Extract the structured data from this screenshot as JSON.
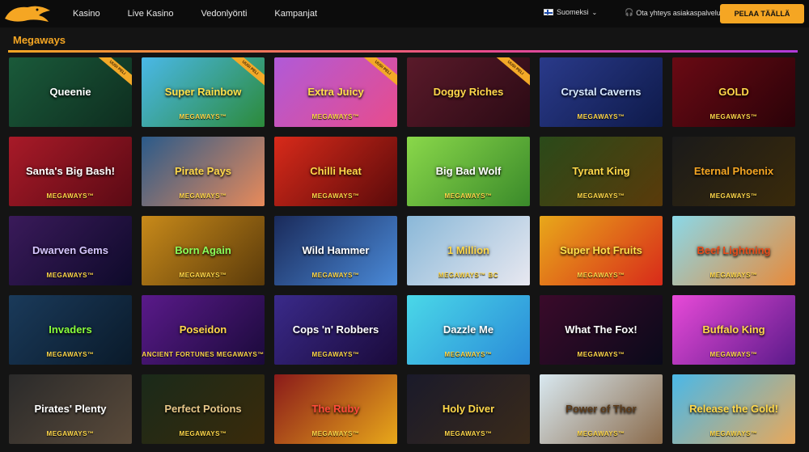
{
  "nav": {
    "items": [
      "Kasino",
      "Live Kasino",
      "Vedonlyönti",
      "Kampanjat"
    ],
    "language": "Suomeksi",
    "support": "Ota yhteys asiakaspalveluun",
    "cta": "PELAA TÄÄLLÄ"
  },
  "section": {
    "title": "Megaways"
  },
  "games": [
    {
      "title": "Queenie",
      "mega": "",
      "ribbon": "UUSI PELI",
      "bg": "linear-gradient(135deg,#1a5a3a,#0e2d1f)",
      "color": "#ffffff"
    },
    {
      "title": "Super Rainbow",
      "mega": "MEGAWAYS™",
      "ribbon": "UUSI PELI",
      "bg": "linear-gradient(135deg,#4ab8e8,#2c8a3a)",
      "color": "#ffe04a"
    },
    {
      "title": "Extra Juicy",
      "mega": "MEGAWAYS™",
      "ribbon": "UUSI PELI",
      "bg": "linear-gradient(135deg,#b05ad8,#e84c8c)",
      "color": "#ffe04a"
    },
    {
      "title": "Doggy Riches",
      "mega": "",
      "ribbon": "UUSI PELI",
      "bg": "linear-gradient(135deg,#5a1a2a,#2a0a14)",
      "color": "#ffd84a"
    },
    {
      "title": "Crystal Caverns",
      "mega": "MEGAWAYS™",
      "ribbon": "",
      "bg": "linear-gradient(135deg,#2a3a8a,#0e1a4a)",
      "color": "#d8eaff"
    },
    {
      "title": "GOLD",
      "mega": "MEGAWAYS™",
      "ribbon": "",
      "bg": "linear-gradient(135deg,#6a0a14,#2a0208)",
      "color": "#ffd84a"
    },
    {
      "title": "Santa's Big Bash!",
      "mega": "MEGAWAYS™",
      "ribbon": "",
      "bg": "linear-gradient(135deg,#a81a28,#5a0a14)",
      "color": "#ffffff"
    },
    {
      "title": "Pirate Pays",
      "mega": "MEGAWAYS™",
      "ribbon": "",
      "bg": "linear-gradient(135deg,#2a5a8a,#e88a5a)",
      "color": "#ffd84a"
    },
    {
      "title": "Chilli Heat",
      "mega": "MEGAWAYS™",
      "ribbon": "",
      "bg": "linear-gradient(135deg,#d82a1a,#5a0a0a)",
      "color": "#ffd84a"
    },
    {
      "title": "Big Bad Wolf",
      "mega": "MEGAWAYS™",
      "ribbon": "",
      "bg": "linear-gradient(135deg,#8ad84a,#3a8a2a)",
      "color": "#ffffff"
    },
    {
      "title": "Tyrant King",
      "mega": "MEGAWAYS™",
      "ribbon": "",
      "bg": "linear-gradient(135deg,#2a4a1a,#5a3a0a)",
      "color": "#ffd84a"
    },
    {
      "title": "Eternal Phoenix",
      "mega": "MEGAWAYS™",
      "ribbon": "",
      "bg": "linear-gradient(135deg,#1a1a1a,#3a2a0a)",
      "color": "#f5a623"
    },
    {
      "title": "Dwarven Gems",
      "mega": "MEGAWAYS™",
      "ribbon": "",
      "bg": "linear-gradient(135deg,#3a1a5a,#0e0a2a)",
      "color": "#d8c8ff"
    },
    {
      "title": "Born Again",
      "mega": "MEGAWAYS™",
      "ribbon": "",
      "bg": "linear-gradient(135deg,#c88a1a,#5a3a0a)",
      "color": "#8aff5a"
    },
    {
      "title": "Wild Hammer",
      "mega": "MEGAWAYS™",
      "ribbon": "",
      "bg": "linear-gradient(135deg,#1a2a5a,#4a8ad8)",
      "color": "#ffffff"
    },
    {
      "title": "1 Million",
      "mega": "MEGAWAYS™ BC",
      "ribbon": "",
      "bg": "linear-gradient(135deg,#8ab8d8,#e8e8f0)",
      "color": "#ffd84a"
    },
    {
      "title": "Super Hot Fruits",
      "mega": "MEGAWAYS™",
      "ribbon": "",
      "bg": "linear-gradient(135deg,#e8a81a,#d82a1a)",
      "color": "#ffe04a"
    },
    {
      "title": "Beef Lightning",
      "mega": "MEGAWAYS™",
      "ribbon": "",
      "bg": "linear-gradient(135deg,#8ad8e8,#e88a3a)",
      "color": "#e84c1a"
    },
    {
      "title": "Invaders",
      "mega": "MEGAWAYS™",
      "ribbon": "",
      "bg": "linear-gradient(135deg,#1a3a5a,#0a1a2a)",
      "color": "#8aff3a"
    },
    {
      "title": "Poseidon",
      "mega": "ANCIENT FORTUNES MEGAWAYS™",
      "ribbon": "",
      "bg": "linear-gradient(135deg,#5a1a8a,#1a0a3a)",
      "color": "#ffd84a"
    },
    {
      "title": "Cops 'n' Robbers",
      "mega": "MEGAWAYS™",
      "ribbon": "",
      "bg": "linear-gradient(135deg,#3a2a8a,#1a0a3a)",
      "color": "#ffffff"
    },
    {
      "title": "Dazzle Me",
      "mega": "MEGAWAYS™",
      "ribbon": "",
      "bg": "linear-gradient(135deg,#4ad8e8,#2a8ad8)",
      "color": "#ffffff"
    },
    {
      "title": "What The Fox!",
      "mega": "MEGAWAYS™",
      "ribbon": "",
      "bg": "linear-gradient(135deg,#3a0a2a,#0a0a1a)",
      "color": "#ffffff"
    },
    {
      "title": "Buffalo King",
      "mega": "MEGAWAYS™",
      "ribbon": "",
      "bg": "linear-gradient(135deg,#e84ad8,#5a1a8a)",
      "color": "#ffd84a"
    },
    {
      "title": "Pirates' Plenty",
      "mega": "MEGAWAYS™",
      "ribbon": "",
      "bg": "linear-gradient(135deg,#2a2a2a,#5a4a3a)",
      "color": "#ffffff"
    },
    {
      "title": "Perfect Potions",
      "mega": "MEGAWAYS™",
      "ribbon": "",
      "bg": "linear-gradient(135deg,#1a2a1a,#3a2a0a)",
      "color": "#e8c88a"
    },
    {
      "title": "The Ruby",
      "mega": "MEGAWAYS™",
      "ribbon": "",
      "bg": "linear-gradient(135deg,#8a1a1a,#e8a81a)",
      "color": "#ff4a3a"
    },
    {
      "title": "Holy Diver",
      "mega": "MEGAWAYS™",
      "ribbon": "",
      "bg": "linear-gradient(135deg,#1a1a2a,#3a2a1a)",
      "color": "#ffd84a"
    },
    {
      "title": "Power of Thor",
      "mega": "MEGAWAYS™",
      "ribbon": "",
      "bg": "linear-gradient(135deg,#d8e8f0,#8a6a4a)",
      "color": "#5a3a1a"
    },
    {
      "title": "Release the Gold!",
      "mega": "MEGAWAYS™",
      "ribbon": "",
      "bg": "linear-gradient(135deg,#4ab8e8,#e8a85a)",
      "color": "#ffd84a"
    }
  ]
}
